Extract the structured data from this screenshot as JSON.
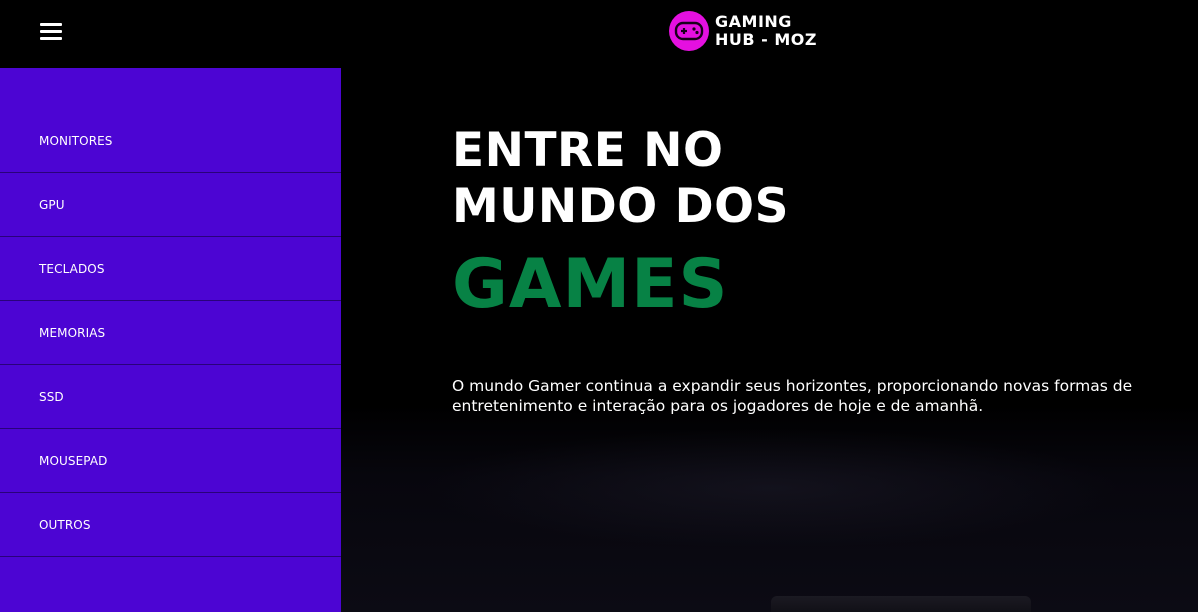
{
  "header": {
    "menu_icon": "hamburger-menu-icon",
    "logo": {
      "icon": "gamepad-icon",
      "line1": "GAMING",
      "line2": "HUB - MOZ",
      "accent_color": "#e510e0"
    }
  },
  "sidebar": {
    "background_color": "#4c05d3",
    "items": [
      {
        "label": "MONITORES"
      },
      {
        "label": "GPU"
      },
      {
        "label": "TECLADOS"
      },
      {
        "label": "MEMORIAS"
      },
      {
        "label": "SSD"
      },
      {
        "label": "MOUSEPAD"
      },
      {
        "label": "OUTROS"
      }
    ]
  },
  "hero": {
    "title_line1": "ENTRE NO",
    "title_line2": "MUNDO DOS",
    "highlight": "GAMES",
    "highlight_color": "#078245",
    "description": "O mundo Gamer continua a expandir seus horizontes, proporcionando novas formas de entretenimento e interação para os jogadores de hoje e de amanhã."
  }
}
